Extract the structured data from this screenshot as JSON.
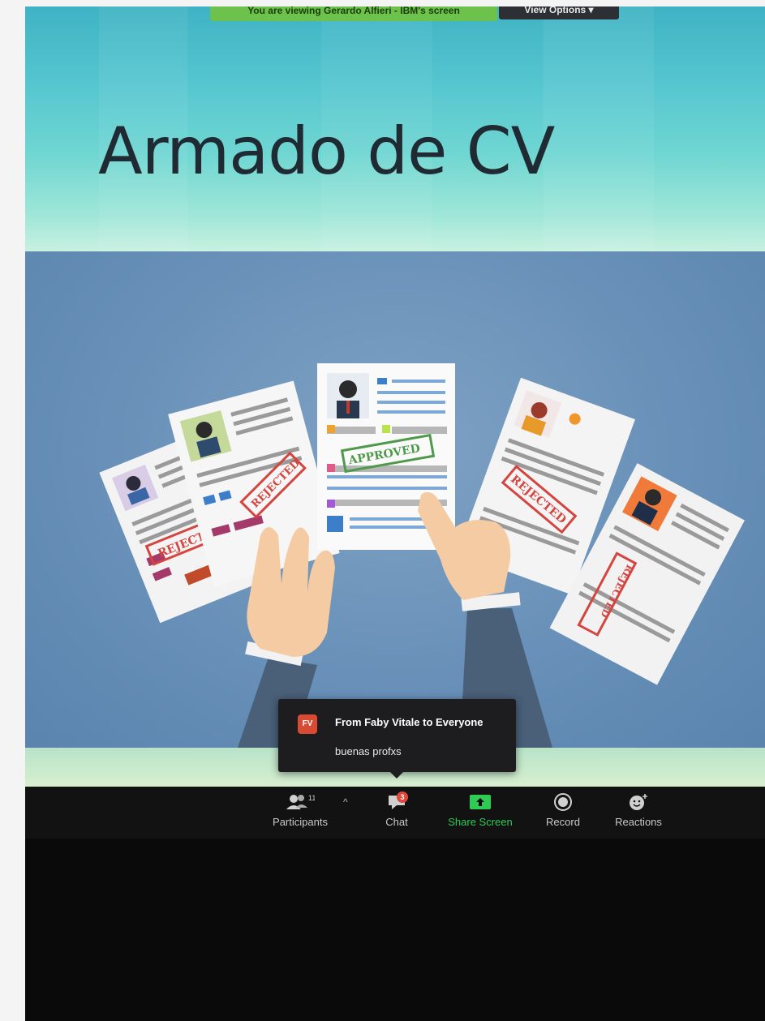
{
  "share_banner": {
    "text": "You are viewing Gerardo Alfieri - IBM's screen",
    "view_options": "View Options ▾"
  },
  "slide": {
    "title": "Armado de CV",
    "stamps": {
      "approved": "APPROVED",
      "rejected": "REJECTED",
      "rejected_partial": "REJECT"
    }
  },
  "chat_toast": {
    "avatar": "FV",
    "from": "From Faby Vitale to Everyone",
    "message": "buenas profxs"
  },
  "toolbar": {
    "participants": {
      "label": "Participants",
      "count": "11",
      "caret": "^"
    },
    "chat": {
      "label": "Chat",
      "badge": "3"
    },
    "share": {
      "label": "Share Screen"
    },
    "record": {
      "label": "Record"
    },
    "reactions": {
      "label": "Reactions"
    }
  },
  "colors": {
    "share_green": "#2ecc55",
    "badge_red": "#e0483c",
    "banner_green": "#6cc24a"
  }
}
